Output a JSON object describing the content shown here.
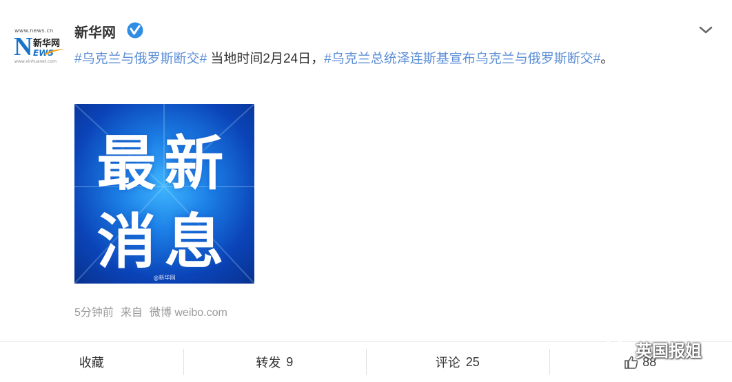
{
  "post": {
    "author": "新华网",
    "text": {
      "tag1": "#乌克兰与俄罗斯断交#",
      "body": " 当地时间2月24日，",
      "tag2": "#乌克兰总统泽连斯基宣布乌克兰与俄罗斯断交#",
      "end": "。"
    },
    "image": {
      "line1": "最新",
      "line2": "消息",
      "watermark": "@新华网"
    },
    "meta": {
      "time": "5分钟前",
      "source_prefix": "来自",
      "source": "微博 weibo.com"
    }
  },
  "avatar": {
    "site": "www.news.cn",
    "letter": "N",
    "cn": "新华网",
    "ews": "EWS",
    "sub": "www.xinhuanet.com"
  },
  "actions": {
    "favorite": "收藏",
    "repost_label": "转发",
    "repost_count": "9",
    "comment_label": "评论",
    "comment_count": "25",
    "like_count": "88"
  },
  "watermark": {
    "text": "英国报姐"
  },
  "icons": {
    "verified": "verified-badge-icon",
    "menu": "chevron-down-icon",
    "like": "thumbs-up-icon",
    "wechat": "wechat-icon"
  },
  "colors": {
    "hashtag": "#5b8ed6",
    "verified": "#2f8de4",
    "meta": "#999999"
  }
}
